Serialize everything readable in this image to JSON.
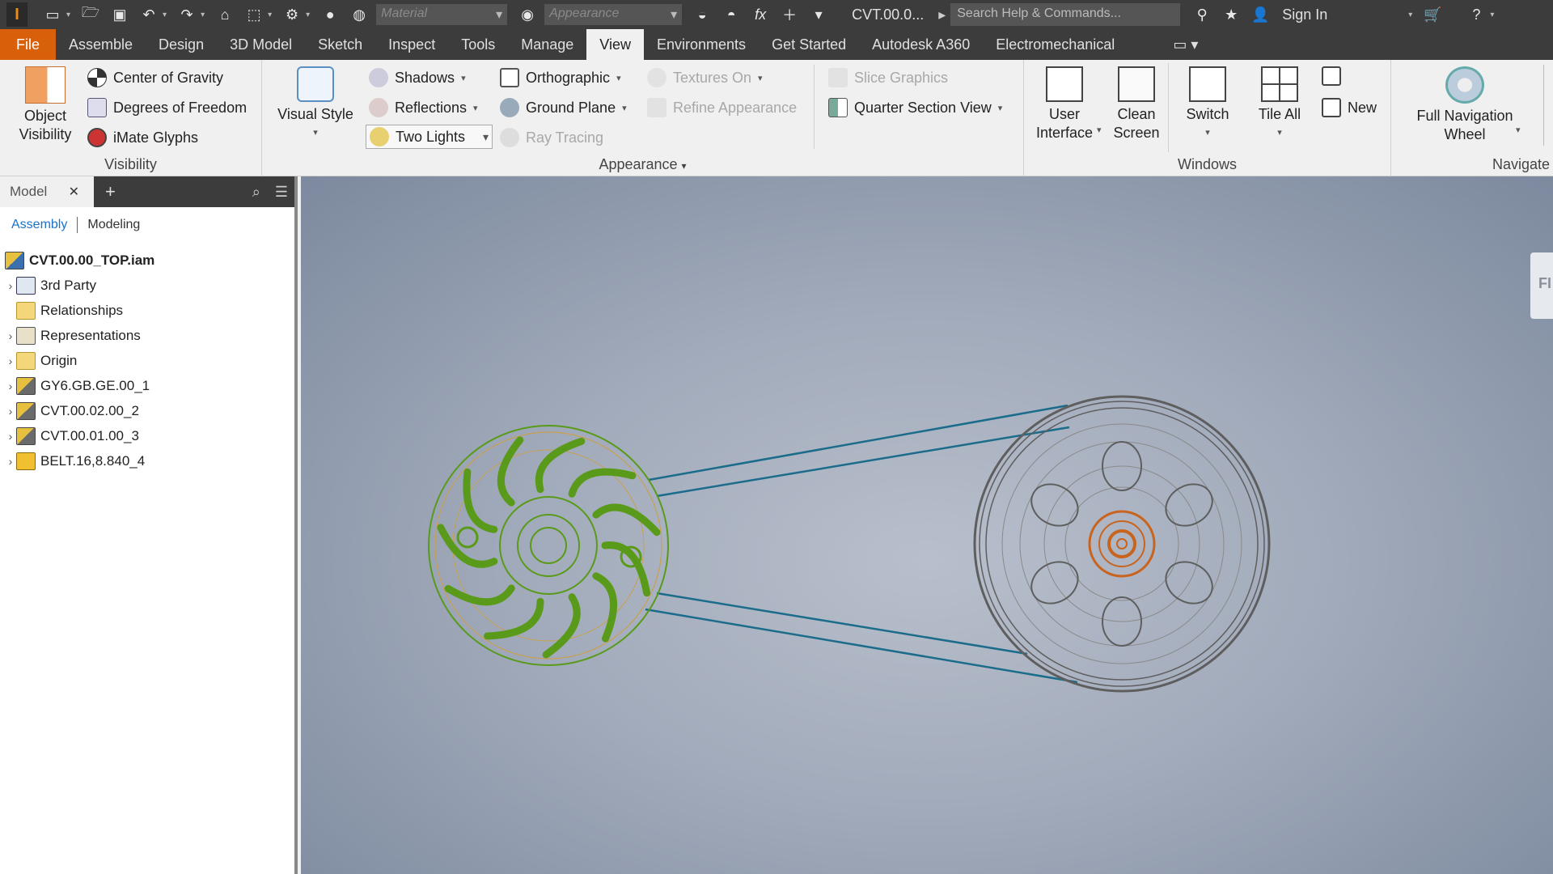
{
  "qat": {
    "app_letter": "I",
    "material_placeholder": "Material",
    "appearance_placeholder": "Appearance",
    "fx_label": "fx",
    "doc_title": "CVT.00.0...",
    "search_placeholder": "Search Help & Commands...",
    "sign_in": "Sign In"
  },
  "tabs": [
    "File",
    "Assemble",
    "Design",
    "3D Model",
    "Sketch",
    "Inspect",
    "Tools",
    "Manage",
    "View",
    "Environments",
    "Get Started",
    "Autodesk A360",
    "Electromechanical"
  ],
  "active_tab": "View",
  "ribbon": {
    "visibility": {
      "title": "Visibility",
      "object_visibility": [
        "Object",
        "Visibility"
      ],
      "center_of_gravity": "Center of Gravity",
      "degrees_of_freedom": "Degrees of Freedom",
      "imate_glyphs": "iMate Glyphs"
    },
    "appearance": {
      "title": "Appearance",
      "visual_style": "Visual Style",
      "shadows": "Shadows",
      "reflections": "Reflections",
      "two_lights": "Two Lights",
      "orthographic": "Orthographic",
      "ground_plane": "Ground Plane",
      "ray_tracing": "Ray Tracing",
      "textures_on": "Textures On",
      "refine_appearance": "Refine Appearance",
      "slice_graphics": "Slice Graphics",
      "quarter_section_view": "Quarter Section View"
    },
    "windows": {
      "title": "Windows",
      "user_interface": [
        "User",
        "Interface"
      ],
      "clean_screen": [
        "Clean",
        "Screen"
      ],
      "switch": "Switch",
      "tile_all": "Tile All",
      "new": "New"
    },
    "navigate": {
      "title": "Navigate",
      "full_navigation_wheel": [
        "Full Navigation",
        "Wheel"
      ]
    }
  },
  "browser": {
    "tab_label": "Model",
    "subtab_assembly": "Assembly",
    "subtab_modeling": "Modeling",
    "root": "CVT.00.00_TOP.iam",
    "items": [
      {
        "label": "3rd Party",
        "expandable": true,
        "icon": "third-party-icon"
      },
      {
        "label": "Relationships",
        "expandable": false,
        "icon": "folder-icon"
      },
      {
        "label": "Representations",
        "expandable": true,
        "icon": "representations-icon"
      },
      {
        "label": "Origin",
        "expandable": true,
        "icon": "folder-icon"
      },
      {
        "label": "GY6.GB.GE.00_1",
        "expandable": true,
        "icon": "subassembly-icon"
      },
      {
        "label": "CVT.00.02.00_2",
        "expandable": true,
        "icon": "subassembly-icon"
      },
      {
        "label": "CVT.00.01.00_3",
        "expandable": true,
        "icon": "subassembly-icon"
      },
      {
        "label": "BELT.16,8.840_4",
        "expandable": true,
        "icon": "part-icon"
      }
    ]
  },
  "viewport": {
    "viewcube_label": "FI"
  },
  "colors": {
    "accent_file_tab": "#d9600a",
    "dark_chrome": "#3c3c3c",
    "pulley_green": "#5a9a1a",
    "belt_line": "#1a6c8a",
    "pulley_grey": "#6a6a6a",
    "hub_orange": "#c8641e"
  }
}
